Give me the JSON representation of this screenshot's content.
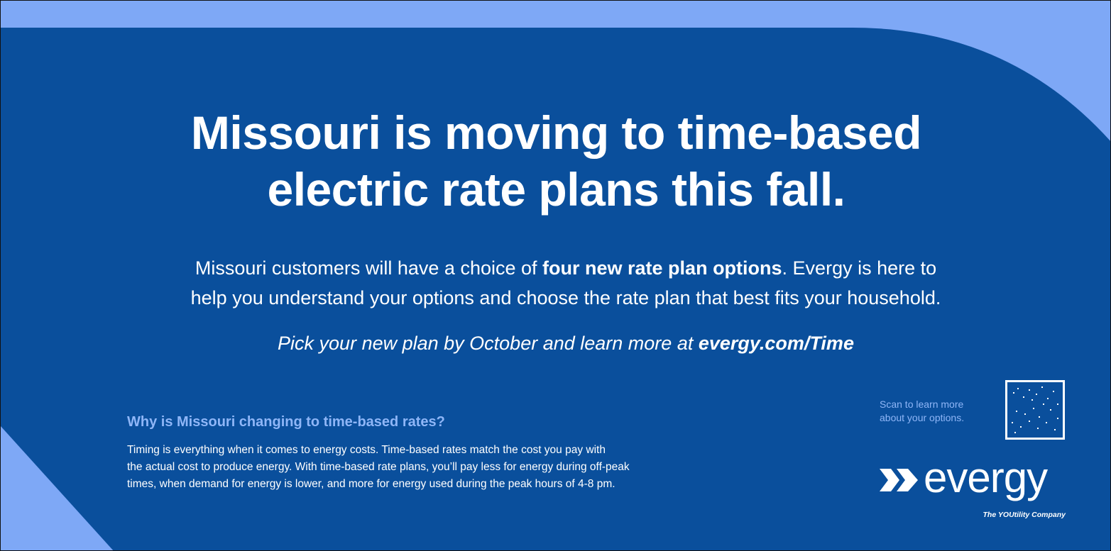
{
  "colors": {
    "background_main": "#0a4f9c",
    "background_light": "#7ea8f6",
    "accent_text": "#8fb6f7",
    "text": "#ffffff"
  },
  "headline": {
    "line1": "Missouri is moving to time-based",
    "line2": "electric rate plans this fall."
  },
  "subcopy": {
    "before": "Missouri customers will have a choice of ",
    "bold": "four new rate plan options",
    "after_line1": ". Evergy is here to",
    "line2": "help you understand your options and choose the rate plan that best fits your household."
  },
  "cta": {
    "text": "Pick your new plan by October and learn more at ",
    "link": "evergy.com/Time"
  },
  "why": {
    "title": "Why is Missouri changing to time-based rates?",
    "line1": "Timing is everything when it comes to energy costs. Time-based rates match the cost you pay with",
    "line2": "the actual cost to produce energy. With time-based rate plans, you’ll pay less for energy during off-peak",
    "line3": "times, when demand for energy is lower, and more for energy used during the peak hours of 4-8 pm."
  },
  "scan": {
    "line1": "Scan to learn more",
    "line2": "about your options."
  },
  "brand": {
    "name": "evergy",
    "tagline": "The YOUtility Company",
    "logo_icon": "double-chevron-icon"
  }
}
